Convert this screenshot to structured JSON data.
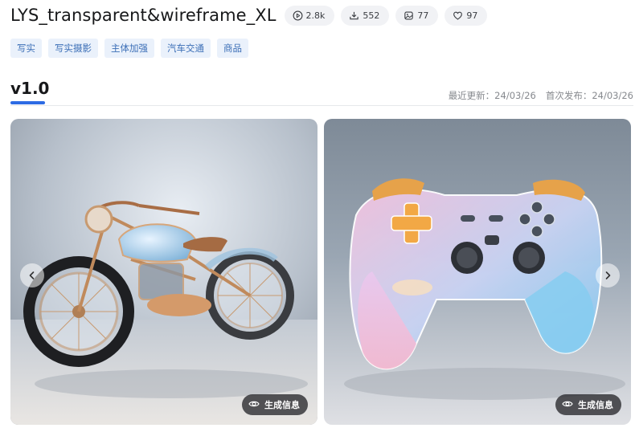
{
  "model": {
    "title": "LYS_transparent&wireframe_XL",
    "stats": [
      {
        "icon": "play-icon",
        "value": "2.8k"
      },
      {
        "icon": "download-icon",
        "value": "552"
      },
      {
        "icon": "image-icon",
        "value": "77"
      },
      {
        "icon": "heart-icon",
        "value": "97"
      }
    ]
  },
  "tags": [
    "写实",
    "写实摄影",
    "主体加强",
    "汽车交通",
    "商品"
  ],
  "version": {
    "label": "v1.0",
    "last_updated": "最近更新：24/03/26",
    "first_published": "首次发布：24/03/26"
  },
  "gallery": {
    "images": [
      {
        "subject": "transparent motorcycle",
        "gen_info_label": "生成信息"
      },
      {
        "subject": "transparent game controller",
        "gen_info_label": "生成信息"
      }
    ]
  },
  "colors": {
    "accent": "#2d6be4",
    "tag_bg": "#eaf1fb",
    "tag_text": "#3c6fb7"
  }
}
